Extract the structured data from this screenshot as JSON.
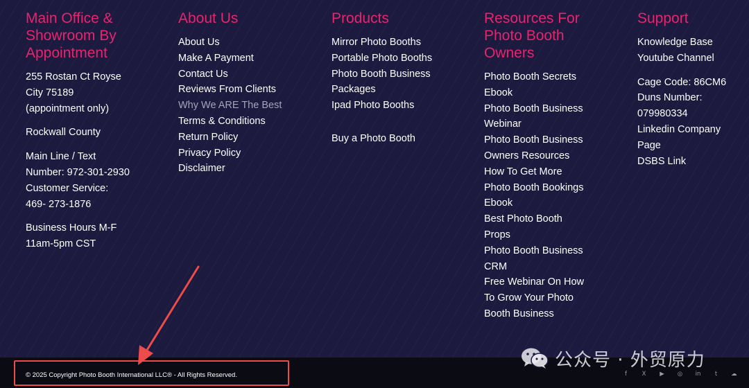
{
  "col1": {
    "heading": [
      "Main Office &",
      "Showroom By",
      "Appointment"
    ],
    "address": [
      "255 Rostan Ct Royse",
      "City 75189",
      "(appointment only)"
    ],
    "county": "Rockwall County",
    "phones": [
      "Main Line / Text",
      "Number: 972-301-2930",
      "Customer Service:",
      "469- 273-1876"
    ],
    "hours": [
      "Business Hours M-F",
      "11am-5pm CST"
    ]
  },
  "col2": {
    "heading": "About Us",
    "links": [
      "About Us",
      "Make A Payment",
      "Contact Us",
      "Reviews From Clients",
      "Why We ARE The Best",
      "Terms & Conditions",
      "Return Policy",
      "Privacy Policy",
      "Disclaimer"
    ]
  },
  "col3": {
    "heading": "Products",
    "links": [
      "Mirror Photo Booths",
      "Portable Photo Booths",
      "Photo Booth Business",
      "Packages",
      "Ipad Photo Booths"
    ],
    "buy": "Buy a Photo Booth"
  },
  "col4": {
    "heading": [
      "Resources For",
      "Photo Booth",
      "Owners"
    ],
    "links": [
      "Photo Booth Secrets",
      "Ebook",
      "Photo Booth Business",
      "Webinar",
      "Photo Booth Business",
      "Owners Resources",
      "How To Get More",
      "Photo Booth Bookings",
      "Ebook",
      "Best Photo Booth",
      "Props",
      "Photo Booth Business",
      "CRM",
      "Free Webinar On How",
      "To Grow Your Photo",
      "Booth Business"
    ]
  },
  "col5": {
    "heading": "Support",
    "links": [
      "Knowledge Base",
      "Youtube Channel"
    ],
    "info": [
      "Cage Code: 86CM6",
      "Duns Number:",
      "079980334"
    ],
    "links2": [
      "Linkedin Company",
      "Page",
      "DSBS Link"
    ]
  },
  "footer": {
    "copyright": "© 2025 Copyright Photo Booth International LLC® - All Rights Reserved.",
    "socials": [
      "f",
      "X",
      "▶",
      "◎",
      "in",
      "t",
      "☁"
    ],
    "social_icons": [
      "facebook-icon",
      "x-icon",
      "youtube-icon",
      "instagram-icon",
      "linkedin-icon",
      "tumblr-icon",
      "soundcloud-icon"
    ]
  },
  "watermark": {
    "text": "公众号 · 外贸原力"
  },
  "colors": {
    "accent": "#e8246f",
    "annotation": "#ee4b4b",
    "background": "#1c1a3e"
  }
}
